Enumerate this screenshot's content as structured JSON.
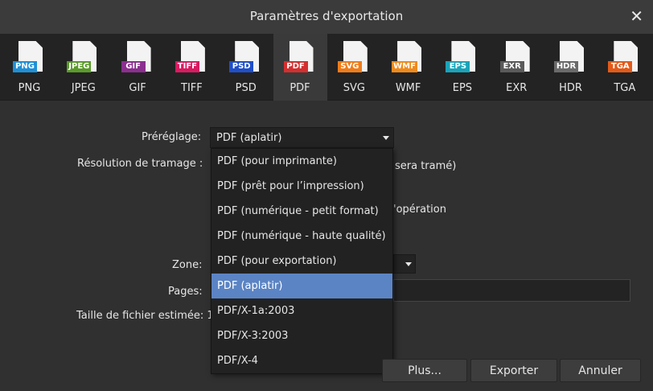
{
  "window": {
    "title": "Paramètres d'exportation"
  },
  "formats": [
    {
      "label": "PNG",
      "badge": "PNG",
      "color": "#1e90d6"
    },
    {
      "label": "JPEG",
      "badge": "JPEG",
      "color": "#5a9a2a"
    },
    {
      "label": "GIF",
      "badge": "GIF",
      "color": "#8b2f8f"
    },
    {
      "label": "TIFF",
      "badge": "TIFF",
      "color": "#d81b60"
    },
    {
      "label": "PSD",
      "badge": "PSD",
      "color": "#1f4fc8"
    },
    {
      "label": "PDF",
      "badge": "PDF",
      "color": "#d32f2f"
    },
    {
      "label": "SVG",
      "badge": "SVG",
      "color": "#ef7c1a"
    },
    {
      "label": "WMF",
      "badge": "WMF",
      "color": "#ee8a1c"
    },
    {
      "label": "EPS",
      "badge": "EPS",
      "color": "#1aa3b8"
    },
    {
      "label": "EXR",
      "badge": "EXR",
      "color": "#5a5a5a"
    },
    {
      "label": "HDR",
      "badge": "HDR",
      "color": "#6a6a6a"
    },
    {
      "label": "TGA",
      "badge": "TGA",
      "color": "#e25a1a"
    }
  ],
  "active_format_index": 5,
  "form": {
    "preset_label": "Préréglage:",
    "preset_value": "PDF (aplatir)",
    "raster_label": "Résolution de tramage :",
    "raster_suffix": "sera tramé)",
    "operation_suffix": "'opération",
    "zone_label": "Zone:",
    "pages_label": "Pages:",
    "filesize_label": "Taille de fichier estimée: 1"
  },
  "dropdown": {
    "options": [
      "PDF (pour imprimante)",
      "PDF (prêt pour l’impression)",
      "PDF (numérique - petit format)",
      "PDF (numérique - haute qualité)",
      "PDF (pour exportation)",
      "PDF (aplatir)",
      "PDF/X-1a:2003",
      "PDF/X-3:2003",
      "PDF/X-4"
    ],
    "selected_index": 5
  },
  "buttons": {
    "more": "Plus...",
    "export": "Exporter",
    "cancel": "Annuler"
  },
  "icons": {
    "close": "close-icon",
    "dropdown": "chevron-down-icon",
    "format": "file-icon"
  }
}
